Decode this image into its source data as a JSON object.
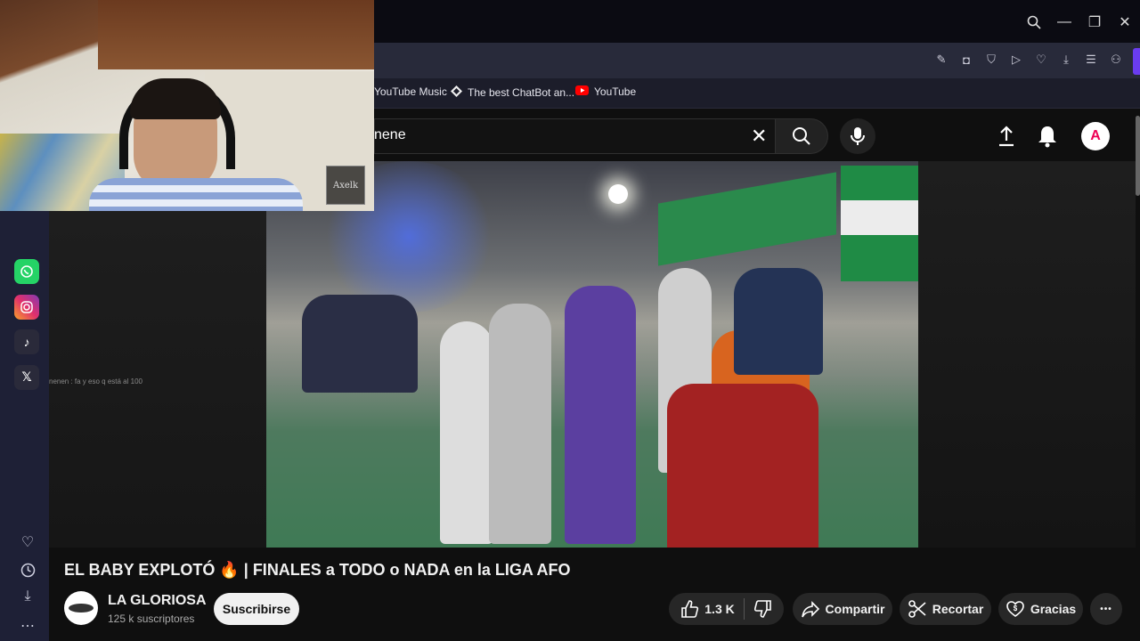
{
  "browser": {
    "window_controls": {
      "search": "search-icon",
      "minimize": "—",
      "restore": "❐",
      "close": "✕"
    },
    "bookmarks": [
      {
        "label": "YouTube Music",
        "icon": "youtube-music-icon"
      },
      {
        "label": "The best ChatBot an...",
        "icon": "chatbot-icon"
      },
      {
        "label": "YouTube",
        "icon": "youtube-icon"
      }
    ]
  },
  "youtube": {
    "search": {
      "value": "nene"
    },
    "avatar_letter": "A"
  },
  "webcam": {
    "logo_text": "Axelk"
  },
  "chat_overlay": {
    "text": "nenen : fa y eso q está al 100"
  },
  "video": {
    "title": "EL BABY EXPLOTÓ 🔥 | FINALES a TODO o NADA en la LIGA AFO",
    "channel_name": "LA GLORIOSA",
    "subscribers": "125 k suscriptores",
    "subscribe_label": "Suscribirse",
    "likes": "1.3 K",
    "share_label": "Compartir",
    "clip_label": "Recortar",
    "thanks_label": "Gracias",
    "more_label": "•••"
  },
  "colors": {
    "accent_purple": "#6a3cf0",
    "youtube_red": "#ff0000",
    "whatsapp_green": "#25d366",
    "sidebar_bg": "#1e2036"
  }
}
